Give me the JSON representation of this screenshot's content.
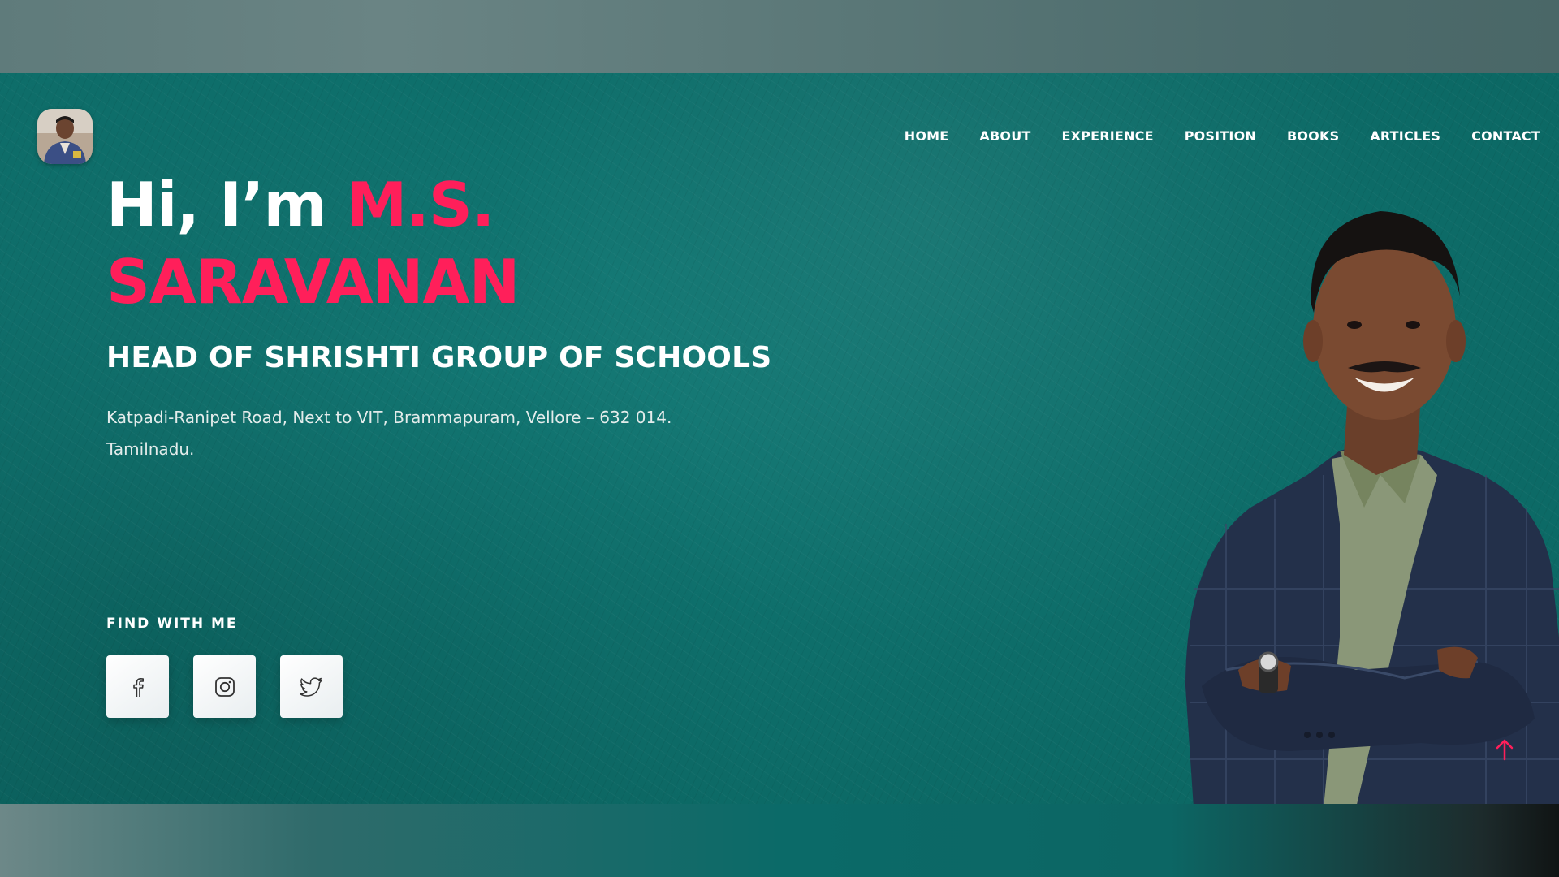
{
  "nav": {
    "items": [
      {
        "label": "HOME"
      },
      {
        "label": "ABOUT"
      },
      {
        "label": "EXPERIENCE"
      },
      {
        "label": "POSITION"
      },
      {
        "label": "BOOKS"
      },
      {
        "label": "ARTICLES"
      },
      {
        "label": "CONTACT"
      }
    ]
  },
  "hero": {
    "greeting": "Hi, I’m ",
    "name_line1": "M.S.",
    "name_line2": "SARAVANAN",
    "role": "HEAD OF SHRISHTI GROUP OF SCHOOLS",
    "address_line1": "Katpadi-Ranipet Road, Next to VIT, Brammapuram, Vellore – 632 014.",
    "address_line2": "Tamilnadu."
  },
  "social": {
    "title": "FIND WITH ME",
    "links": [
      {
        "icon": "facebook-icon"
      },
      {
        "icon": "instagram-icon"
      },
      {
        "icon": "twitter-icon"
      }
    ]
  },
  "colors": {
    "accent": "#ff1f5a",
    "hero_bg": "#0e6f6b"
  }
}
